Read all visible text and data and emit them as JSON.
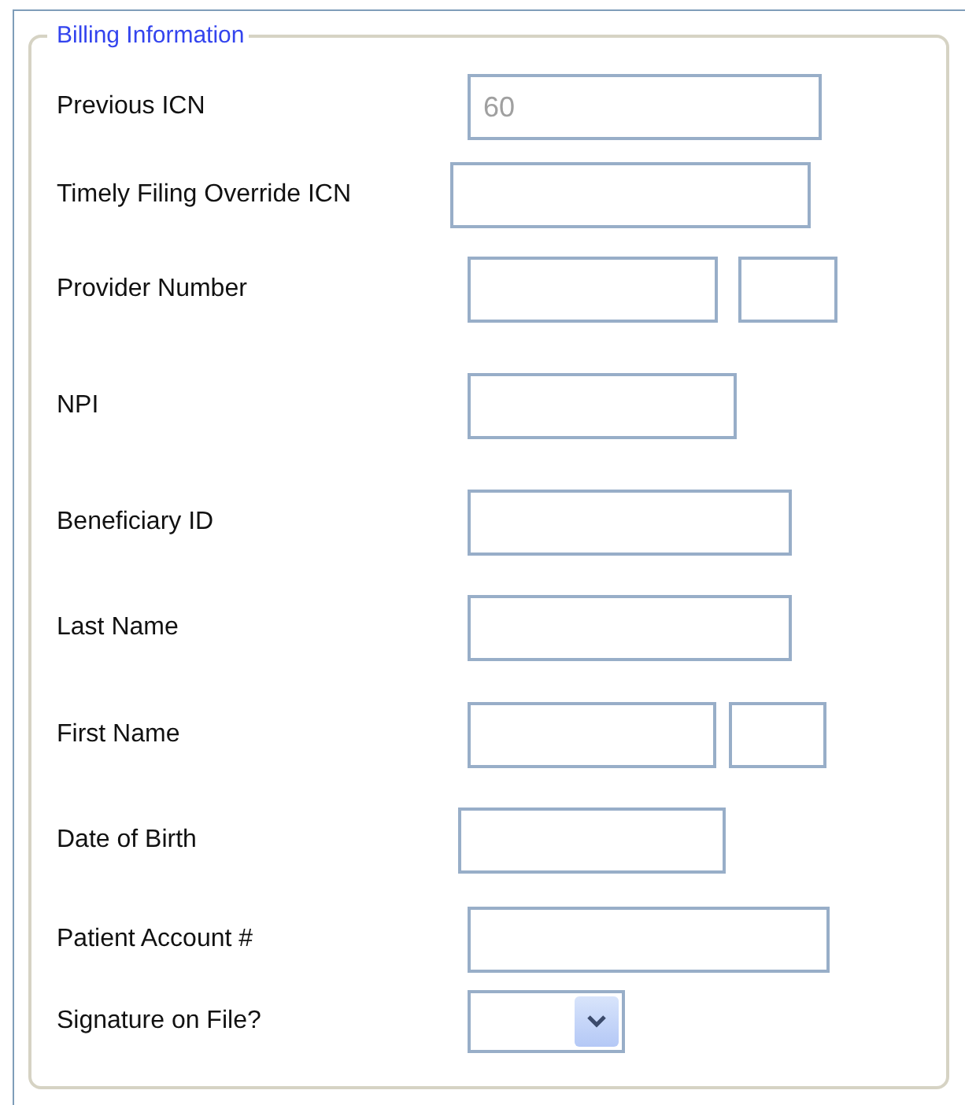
{
  "legend": "Billing Information",
  "fields": [
    {
      "label": "Previous ICN",
      "inputs": [
        {
          "kind": "text",
          "value": "60",
          "disabled": true
        }
      ]
    },
    {
      "label": "Timely Filing Override ICN",
      "inputs": [
        {
          "kind": "text"
        }
      ]
    },
    {
      "label": "Provider Number",
      "inputs": [
        {
          "kind": "text"
        },
        {
          "kind": "text"
        }
      ]
    },
    {
      "label": "NPI",
      "inputs": [
        {
          "kind": "text"
        }
      ]
    },
    {
      "label": "Beneficiary ID",
      "inputs": [
        {
          "kind": "text"
        }
      ]
    },
    {
      "label": "Last Name",
      "inputs": [
        {
          "kind": "text"
        }
      ]
    },
    {
      "label": "First Name",
      "inputs": [
        {
          "kind": "text"
        },
        {
          "kind": "text"
        }
      ]
    },
    {
      "label": "Date of Birth",
      "inputs": [
        {
          "kind": "text"
        }
      ]
    },
    {
      "label": "Patient Account #",
      "inputs": [
        {
          "kind": "text"
        }
      ]
    },
    {
      "label": "Signature on File?",
      "inputs": [
        {
          "kind": "select"
        }
      ]
    }
  ]
}
